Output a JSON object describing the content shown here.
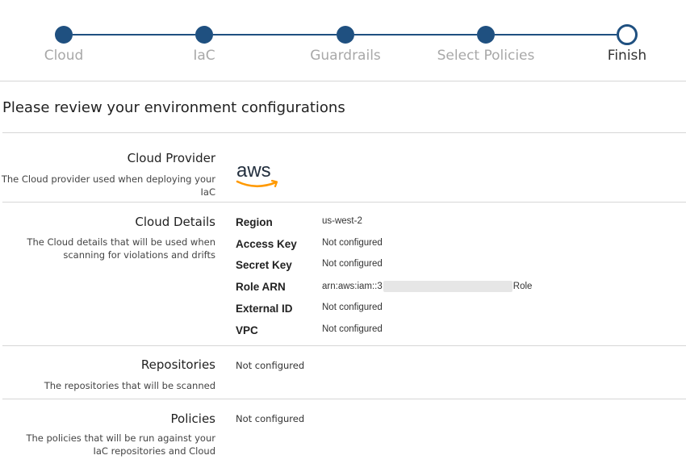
{
  "stepper": {
    "steps": [
      {
        "label": "Cloud",
        "state": "done"
      },
      {
        "label": "IaC",
        "state": "done"
      },
      {
        "label": "Guardrails",
        "state": "done"
      },
      {
        "label": "Select Policies",
        "state": "done"
      },
      {
        "label": "Finish",
        "state": "current"
      }
    ],
    "accent_color": "#1f5080"
  },
  "page_title": "Please review your environment configurations",
  "sections": {
    "cloud_provider": {
      "title": "Cloud Provider",
      "description": "The Cloud provider used when deploying your IaC",
      "logo": "aws",
      "logo_icon": "aws-logo-icon"
    },
    "cloud_details": {
      "title": "Cloud Details",
      "description": "The Cloud details that will be used when scanning for violations and drifts",
      "rows": [
        {
          "key": "Region",
          "value": "us-west-2"
        },
        {
          "key": "Access Key",
          "value": "Not configured"
        },
        {
          "key": "Secret Key",
          "value": "Not configured"
        },
        {
          "key": "Role ARN",
          "value_prefix": "arn:aws:iam::3",
          "value_suffix": "Role"
        },
        {
          "key": "External ID",
          "value": "Not configured"
        },
        {
          "key": "VPC",
          "value": "Not configured"
        }
      ]
    },
    "repositories": {
      "title": "Repositories",
      "description": "The repositories that will be scanned",
      "value": "Not configured"
    },
    "policies": {
      "title": "Policies",
      "description": "The policies that will be run against your IaC repositories and Cloud",
      "value": "Not configured"
    }
  }
}
